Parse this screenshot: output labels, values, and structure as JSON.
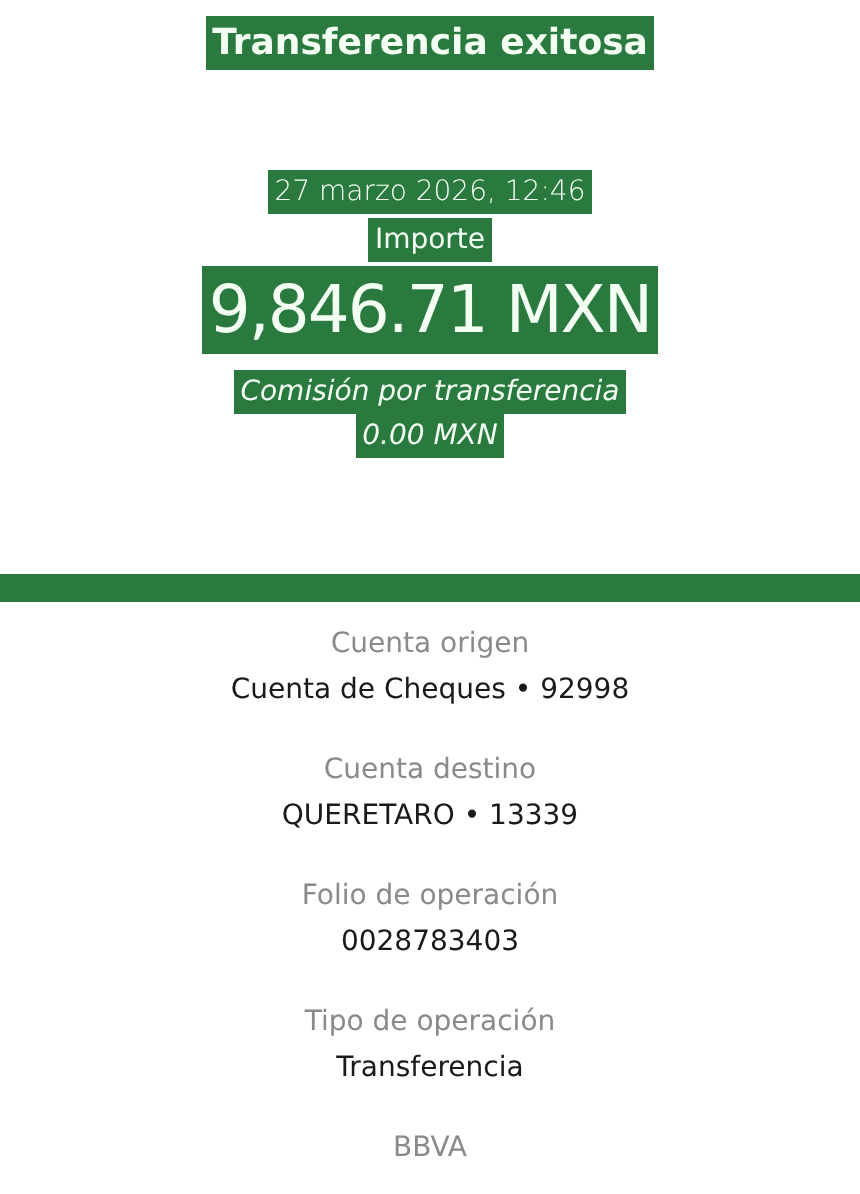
{
  "title": "Transferencia exitosa",
  "date": "27 marzo 2026, 12:46",
  "amount_label": "Importe",
  "amount": "9,846.71 MXN",
  "fee_label": "Comisión por transferencia",
  "fee": "0.00 MXN",
  "details": [
    {
      "label": "Cuenta origen",
      "value": "Cuenta de Cheques • 92998"
    },
    {
      "label": "Cuenta destino",
      "value": "QUERETARO • 13339"
    },
    {
      "label": "Folio de operación",
      "value": "0028783403"
    },
    {
      "label": "Tipo de operación",
      "value": "Transferencia"
    }
  ],
  "footer": "BBVA"
}
